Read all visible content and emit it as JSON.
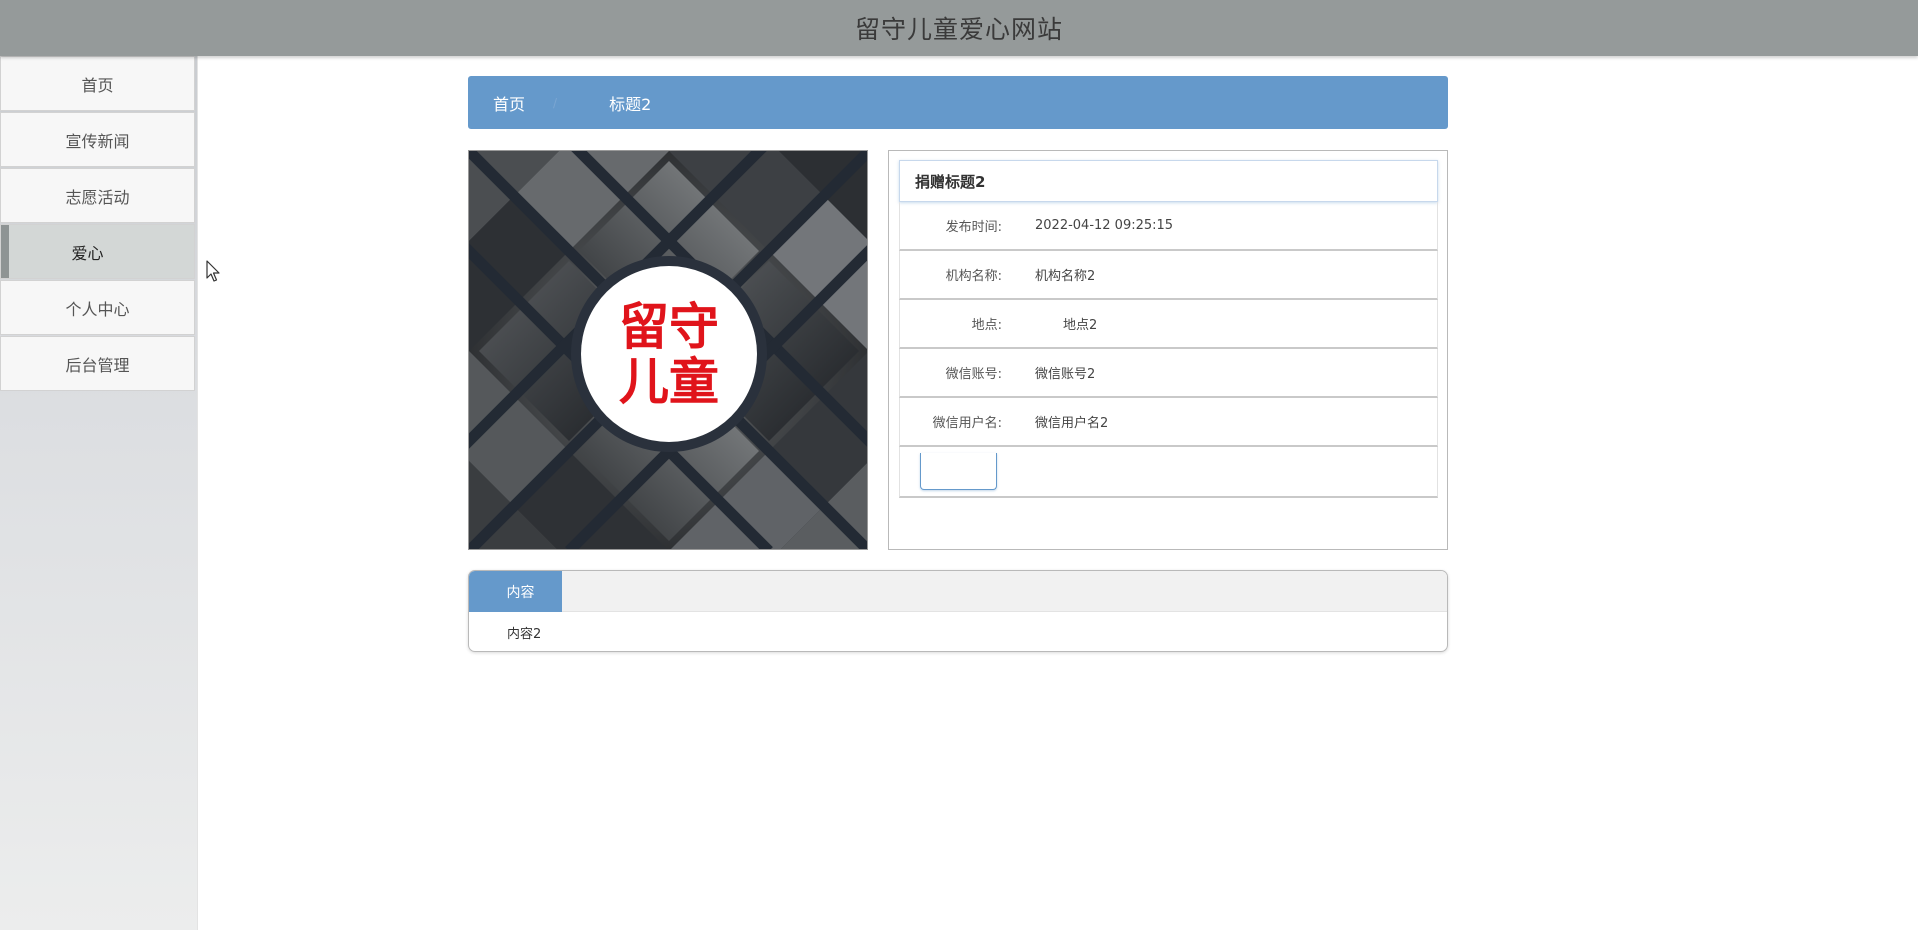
{
  "header": {
    "title": "留守儿童爱心网站"
  },
  "sidebar": {
    "items": [
      {
        "label": "首页"
      },
      {
        "label": "宣传新闻"
      },
      {
        "label": "志愿活动"
      },
      {
        "label": "爱心",
        "active": true
      },
      {
        "label": "个人中心"
      },
      {
        "label": "后台管理"
      }
    ]
  },
  "breadcrumb": {
    "home": "首页",
    "separator": "/",
    "current": "标题2"
  },
  "image": {
    "text_line1": "留守",
    "text_line2": "儿童"
  },
  "detail": {
    "title": "捐赠标题2",
    "rows": [
      {
        "label": "发布时间:",
        "value": "2022-04-12 09:25:15"
      },
      {
        "label": "机构名称:",
        "value": "机构名称2"
      },
      {
        "label": "地点:",
        "value": "地点2"
      },
      {
        "label": "微信账号:",
        "value": "微信账号2"
      },
      {
        "label": "微信用户名:",
        "value": "微信用户名2"
      }
    ]
  },
  "content": {
    "tab_label": "内容",
    "body": "内容2"
  },
  "colors": {
    "header_bg": "#959a9a",
    "accent": "#6599cb",
    "poster_red": "#e0141b"
  }
}
